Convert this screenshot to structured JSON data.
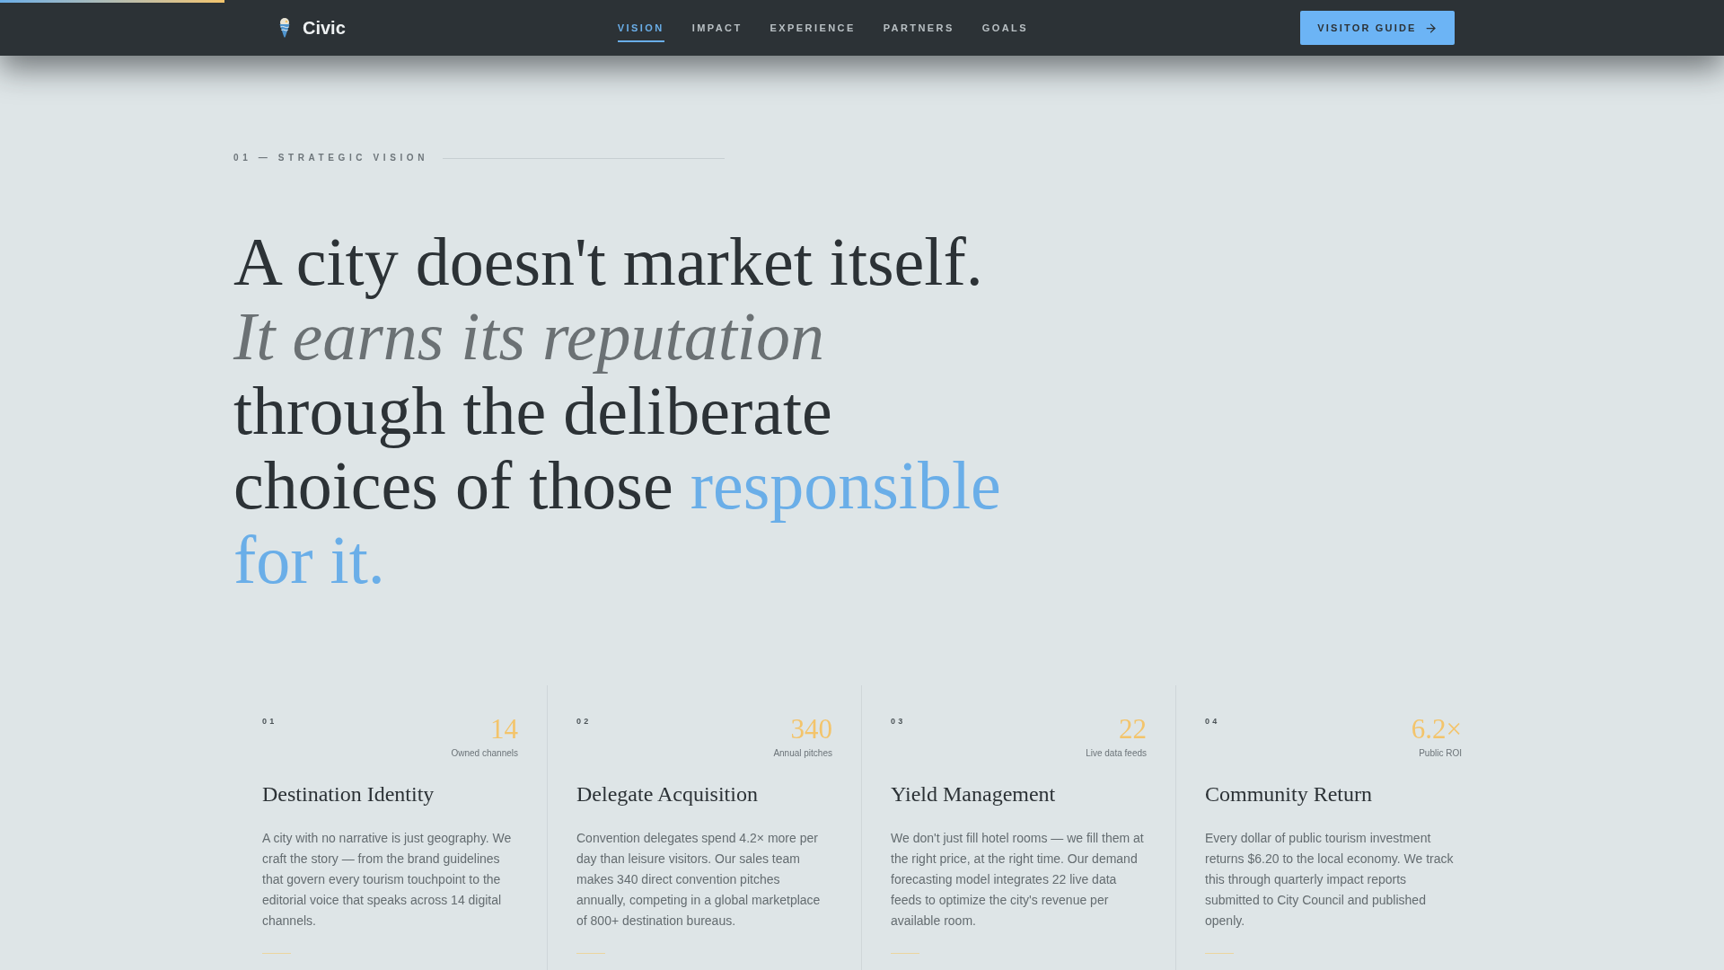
{
  "reading_progress": {
    "level": 0.13
  },
  "nav": {
    "brand": "Civic",
    "links": [
      {
        "label": "VISION",
        "selected": true
      },
      {
        "label": "IMPACT",
        "selected": false
      },
      {
        "label": "EXPERIENCE",
        "selected": false
      },
      {
        "label": "PARTNERS",
        "selected": false
      },
      {
        "label": "GOALS",
        "selected": false
      }
    ],
    "cta": "VISITOR GUIDE"
  },
  "section": {
    "label": "01 — STRATEGIC VISION"
  },
  "headline": {
    "lead": "A city doesn't market itself.",
    "emphasis": "It earns its reputation",
    "body": "through the deliberate choices of those",
    "highlight": "responsible for it."
  },
  "cards": [
    {
      "number": "01",
      "stat": "14",
      "stat_label": "Owned channels",
      "title": "Destination Identity",
      "text": "A city with no narrative is just geography. We craft the story — from the brand guidelines that govern every tourism touchpoint to the editorial voice that speaks across 14 digital channels."
    },
    {
      "number": "02",
      "stat": "340",
      "stat_label": "Annual pitches",
      "title": "Delegate Acquisition",
      "text": "Convention delegates spend 4.2× more per day than leisure visitors. Our sales team makes 340 direct convention pitches annually, competing in a global marketplace of 800+ destination bureaus."
    },
    {
      "number": "03",
      "stat": "22",
      "stat_label": "Live data feeds",
      "title": "Yield Management",
      "text": "We don't just fill hotel rooms — we fill them at the right price, at the right time. Our demand forecasting model integrates 22 live data feeds to optimize the city's revenue per available room."
    },
    {
      "number": "04",
      "stat": "6.2×",
      "stat_label": "Public ROI",
      "title": "Community Return",
      "text": "Every dollar of public tourism investment returns $6.20 to the local economy. We track this through quarterly impact reports submitted to City Council and published openly."
    }
  ]
}
